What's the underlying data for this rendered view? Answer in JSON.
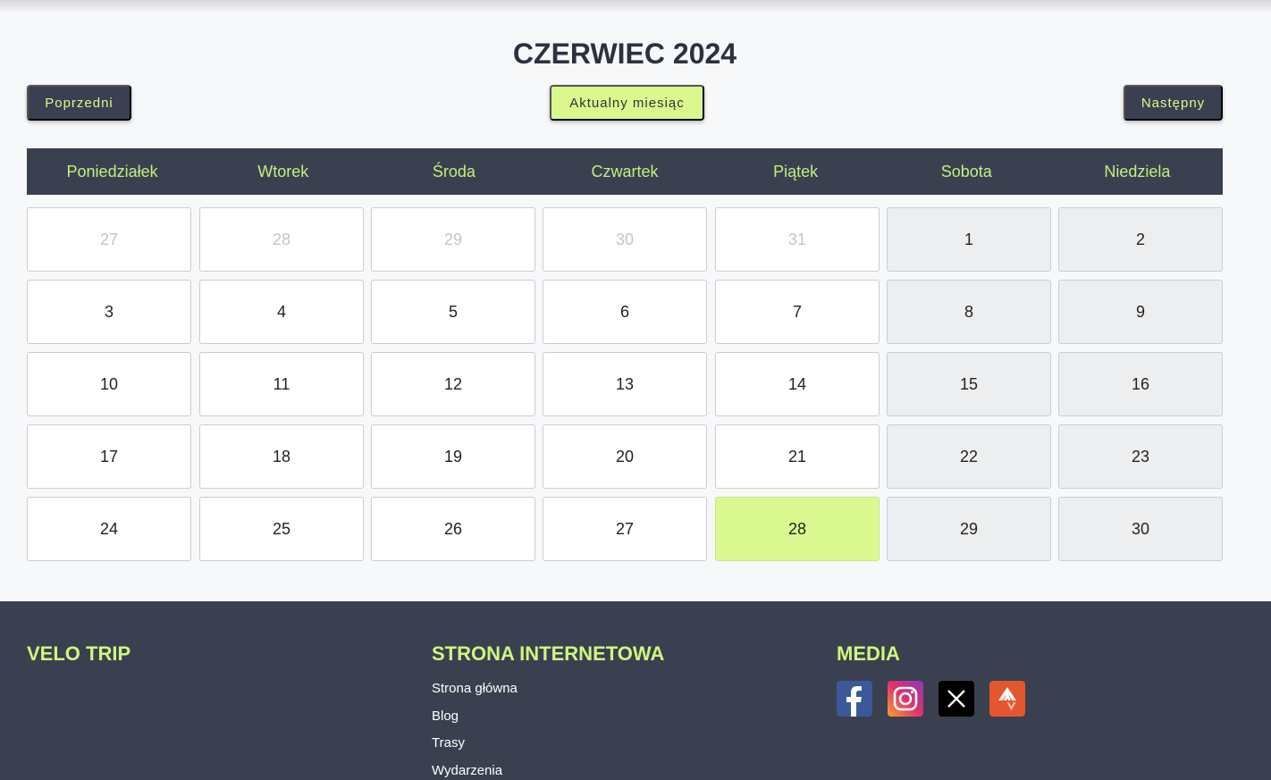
{
  "calendar": {
    "title": "CZERWIEC 2024",
    "prev_label": "Poprzedni",
    "current_label": "Aktualny miesiąc",
    "next_label": "Następny",
    "weekdays": [
      "Poniedziałek",
      "Wtorek",
      "Środa",
      "Czwartek",
      "Piątek",
      "Sobota",
      "Niedziela"
    ],
    "weeks": [
      [
        "27",
        "28",
        "29",
        "30",
        "31",
        "1",
        "2"
      ],
      [
        "3",
        "4",
        "5",
        "6",
        "7",
        "8",
        "9"
      ],
      [
        "10",
        "11",
        "12",
        "13",
        "14",
        "15",
        "16"
      ],
      [
        "17",
        "18",
        "19",
        "20",
        "21",
        "22",
        "23"
      ],
      [
        "24",
        "25",
        "26",
        "27",
        "28",
        "29",
        "30"
      ]
    ],
    "other_month_cells": [
      [
        0,
        0
      ],
      [
        0,
        1
      ],
      [
        0,
        2
      ],
      [
        0,
        3
      ],
      [
        0,
        4
      ]
    ],
    "highlighted_cell": [
      4,
      4
    ],
    "colors": {
      "accent": "#d9f98f",
      "dark": "#3a4050"
    }
  },
  "footer": {
    "brand": "VELO TRIP",
    "site_heading": "STRONA INTERNETOWA",
    "links": [
      "Strona główna",
      "Blog",
      "Trasy",
      "Wydarzenia"
    ],
    "media_heading": "MEDIA",
    "social_icons": [
      "facebook-icon",
      "instagram-icon",
      "x-icon",
      "strava-icon"
    ]
  }
}
